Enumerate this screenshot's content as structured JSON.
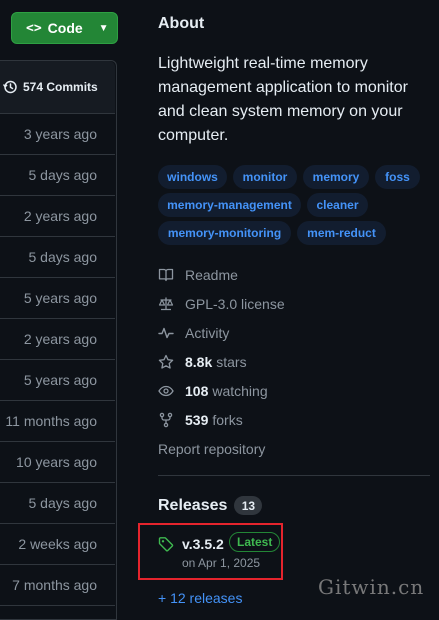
{
  "code_button": {
    "label": "Code",
    "glyph": "<>"
  },
  "commits": {
    "label": "574 Commits",
    "icon": "history-icon"
  },
  "file_rows": [
    "3 years ago",
    "5 days ago",
    "2 years ago",
    "5 days ago",
    "5 years ago",
    "2 years ago",
    "5 years ago",
    "11 months ago",
    "10 years ago",
    "5 days ago",
    "2 weeks ago",
    "7 months ago"
  ],
  "about": {
    "title": "About",
    "description": "Lightweight real-time memory management application to monitor and clean system memory on your computer.",
    "topics": [
      "windows",
      "monitor",
      "memory",
      "foss",
      "memory-management",
      "cleaner",
      "memory-monitoring",
      "mem-reduct"
    ],
    "readme": "Readme",
    "license": "GPL-3.0 license",
    "activity": "Activity",
    "stars_count": "8.8k",
    "stars_label": "stars",
    "watching_count": "108",
    "watching_label": "watching",
    "forks_count": "539",
    "forks_label": "forks",
    "report": "Report repository"
  },
  "releases": {
    "title": "Releases",
    "count": "13",
    "latest_name": "v.3.5.2",
    "latest_badge": "Latest",
    "latest_date": "on Apr 1, 2025",
    "more_link": "+ 12 releases"
  },
  "watermark": "Gitwin.cn",
  "colors": {
    "accent": "#4493f8",
    "green": "#238636",
    "highlight": "#e5242d"
  }
}
